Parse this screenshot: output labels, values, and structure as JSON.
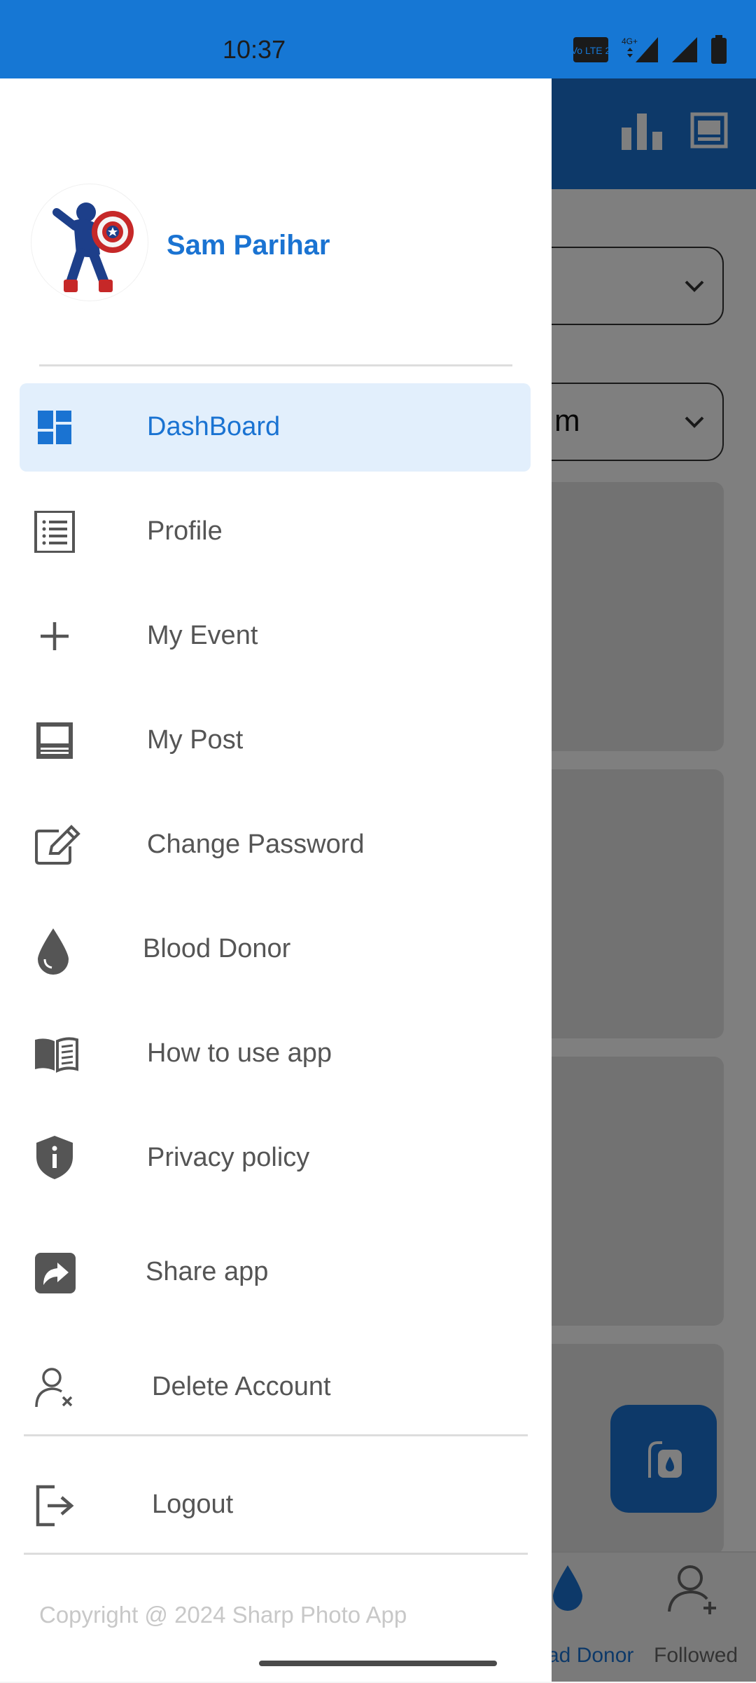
{
  "status_bar": {
    "time": "10:37",
    "network_badge": "Vo LTE 2",
    "network_type": "4G+",
    "icons": [
      "volte-icon",
      "signal-4g-icon",
      "signal-icon",
      "battery-icon"
    ]
  },
  "background_app": {
    "dropdown_value": "m",
    "tabs": [
      {
        "label": "ad Donor",
        "icon": "blood-drop-icon",
        "active": true
      },
      {
        "label": "Followed",
        "icon": "add-user-icon",
        "active": false
      }
    ],
    "header_icons": [
      "bar-chart-icon",
      "article-icon"
    ],
    "fab_icon": "blood-bag-icon"
  },
  "drawer": {
    "user_name": "Sam Parihar",
    "avatar_icon": "captain-america-avatar",
    "menu": [
      {
        "label": "DashBoard",
        "icon": "dashboard-icon",
        "active": true
      },
      {
        "label": "Profile",
        "icon": "list-icon"
      },
      {
        "label": "My Event",
        "icon": "plus-icon"
      },
      {
        "label": "My Post",
        "icon": "post-icon"
      },
      {
        "label": "Change Password",
        "icon": "edit-icon"
      },
      {
        "label": "Blood Donor",
        "icon": "blood-drop-icon"
      },
      {
        "label": "How to use app",
        "icon": "book-icon"
      },
      {
        "label": "Privacy policy",
        "icon": "shield-info-icon"
      },
      {
        "label": "Share app",
        "icon": "share-icon"
      },
      {
        "label": "Delete Account",
        "icon": "delete-user-icon"
      },
      {
        "label": "Logout",
        "icon": "logout-icon"
      }
    ],
    "copyright": "Copyright @ 2024 Sharp Photo App"
  },
  "colors": {
    "primary": "#1a73d2",
    "status_bar": "#1677d4",
    "active_item_bg": "#e2effc",
    "menu_text": "#555555"
  }
}
